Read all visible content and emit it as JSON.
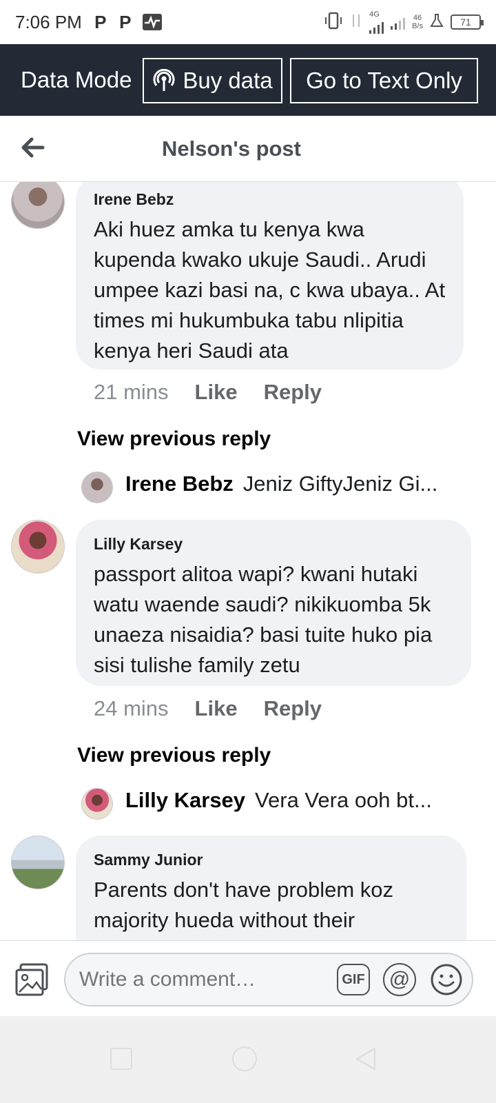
{
  "status_bar": {
    "time": "7:06 PM",
    "network": "4G",
    "speed_value": "46",
    "speed_unit": "B/s",
    "battery": "71",
    "icons": [
      "p-icon",
      "p-icon",
      "pulse-icon",
      "vibrate-icon",
      "signal-icon",
      "flask-icon",
      "battery-icon"
    ]
  },
  "data_bar": {
    "label": "Data Mode",
    "buy_label": "Buy data",
    "text_only_label": "Go to Text Only"
  },
  "header": {
    "title": "Nelson's post"
  },
  "comments": [
    {
      "author": "Irene Bebz",
      "text": "Aki huez amka tu kenya kwa kupenda kwako ukuje Saudi.. Arudi umpee kazi basi na, c kwa ubaya.. At times mi hukumbuka tabu nlipitia kenya heri Saudi ata",
      "time": "21 mins",
      "like": "Like",
      "reply": "Reply",
      "view_previous": "View previous reply",
      "reply_preview_name": "Irene Bebz",
      "reply_preview_text": "Jeniz GiftyJeniz Gi..."
    },
    {
      "author": "Lilly Karsey",
      "text": "passport alitoa wapi? kwani hutaki watu waende saudi? nikikuomba 5k unaeza nisaidia? basi tuite huko pia sisi tulishe family zetu",
      "time": "24 mins",
      "like": "Like",
      "reply": "Reply",
      "view_previous": "View previous reply",
      "reply_preview_name": "Lilly Karsey",
      "reply_preview_text": "Vera Vera ooh bt..."
    },
    {
      "author": "Sammy Junior",
      "text": "Parents don't have problem koz majority hueda without their"
    }
  ],
  "composer": {
    "placeholder": "Write a comment…",
    "gif_label": "GIF",
    "at_label": "@"
  }
}
